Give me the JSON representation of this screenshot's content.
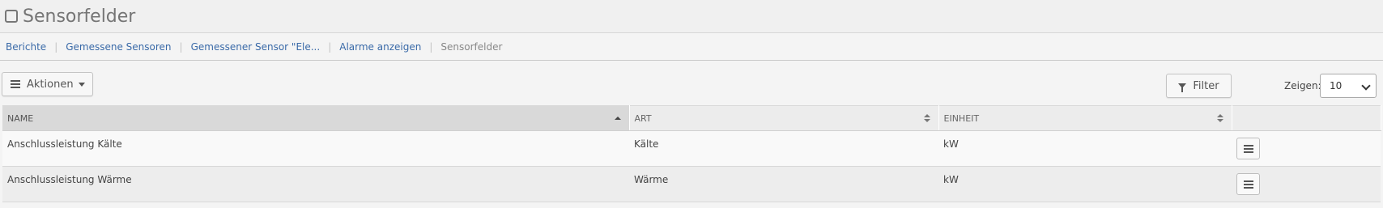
{
  "page": {
    "title": "Sensorfelder"
  },
  "breadcrumb": [
    {
      "label": "Berichte",
      "current": false
    },
    {
      "label": "Gemessene Sensoren",
      "current": false
    },
    {
      "label": "Gemessener Sensor \"Ele...",
      "current": false
    },
    {
      "label": "Alarme anzeigen",
      "current": false
    },
    {
      "label": "Sensorfelder",
      "current": true
    }
  ],
  "toolbar": {
    "actions_label": "Aktionen",
    "filter_label": "Filter",
    "show_label": "Zeigen:",
    "show_value": "10"
  },
  "table": {
    "columns": [
      "NAME",
      "ART",
      "EINHEIT"
    ],
    "rows": [
      {
        "name": "Anschlussleistung Kälte",
        "art": "Kälte",
        "einheit": "kW"
      },
      {
        "name": "Anschlussleistung Wärme",
        "art": "Wärme",
        "einheit": "kW"
      }
    ]
  },
  "colors": {
    "link": "#3a6aa8",
    "header_bg": "#f0f0f0",
    "sorted_header_bg": "#d9d9d9"
  }
}
